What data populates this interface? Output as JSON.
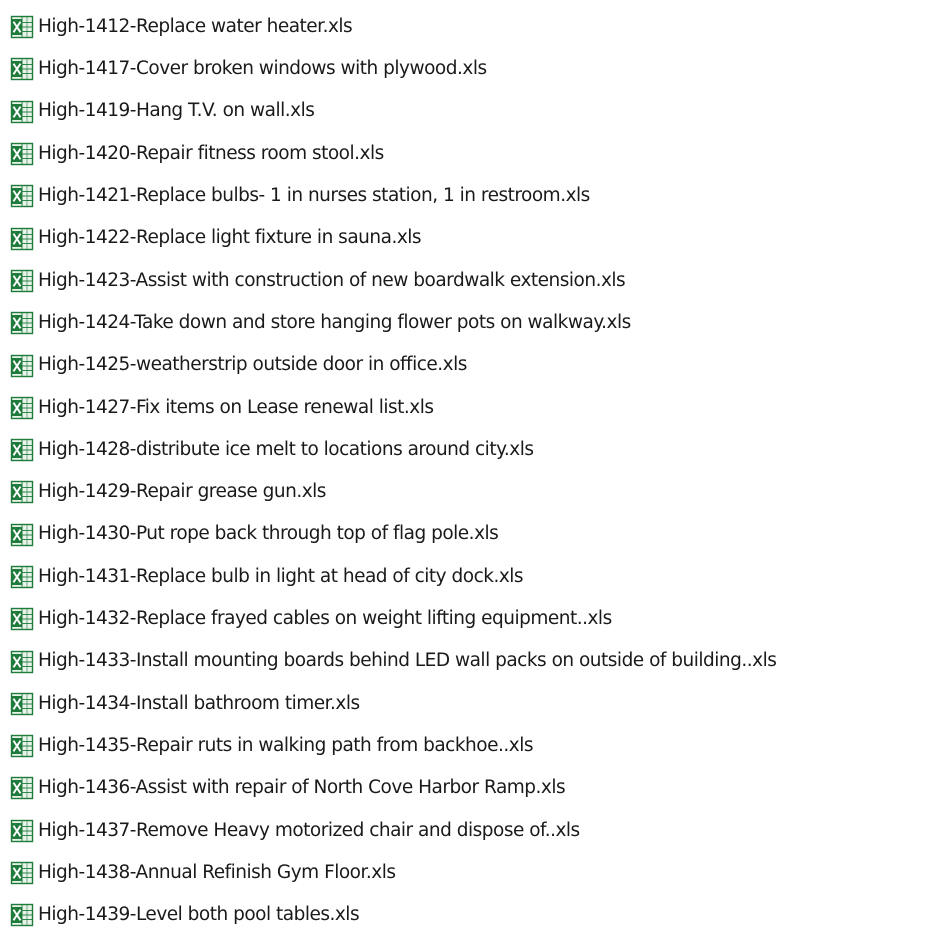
{
  "files": [
    {
      "name": "High-1412-Replace water heater.xls",
      "icon": "excel-file-icon"
    },
    {
      "name": "High-1417-Cover broken windows with plywood.xls",
      "icon": "excel-file-icon"
    },
    {
      "name": "High-1419-Hang T.V. on wall.xls",
      "icon": "excel-file-icon"
    },
    {
      "name": "High-1420-Repair fitness room stool.xls",
      "icon": "excel-file-icon"
    },
    {
      "name": "High-1421-Replace bulbs- 1 in nurses station, 1 in restroom.xls",
      "icon": "excel-file-icon"
    },
    {
      "name": "High-1422-Replace light fixture in sauna.xls",
      "icon": "excel-file-icon"
    },
    {
      "name": "High-1423-Assist with construction of new boardwalk extension.xls",
      "icon": "excel-file-icon"
    },
    {
      "name": "High-1424-Take down and store hanging flower pots on walkway.xls",
      "icon": "excel-file-icon"
    },
    {
      "name": "High-1425-weatherstrip outside door in office.xls",
      "icon": "excel-file-icon"
    },
    {
      "name": "High-1427-Fix items on Lease renewal list.xls",
      "icon": "excel-file-icon"
    },
    {
      "name": "High-1428-distribute ice melt to locations around city.xls",
      "icon": "excel-file-icon"
    },
    {
      "name": "High-1429-Repair grease gun.xls",
      "icon": "excel-file-icon"
    },
    {
      "name": "High-1430-Put rope back through top of flag pole.xls",
      "icon": "excel-file-icon"
    },
    {
      "name": "High-1431-Replace bulb in light at head of city dock.xls",
      "icon": "excel-file-icon"
    },
    {
      "name": "High-1432-Replace frayed cables on weight lifting equipment..xls",
      "icon": "excel-file-icon"
    },
    {
      "name": "High-1433-Install mounting boards behind LED wall packs on outside of building..xls",
      "icon": "excel-file-icon"
    },
    {
      "name": "High-1434-Install bathroom timer.xls",
      "icon": "excel-file-icon"
    },
    {
      "name": "High-1435-Repair ruts in walking path from backhoe..xls",
      "icon": "excel-file-icon"
    },
    {
      "name": "High-1436-Assist with repair of North Cove Harbor Ramp.xls",
      "icon": "excel-file-icon"
    },
    {
      "name": "High-1437-Remove Heavy motorized chair and dispose of..xls",
      "icon": "excel-file-icon"
    },
    {
      "name": "High-1438-Annual Refinish Gym Floor.xls",
      "icon": "excel-file-icon"
    },
    {
      "name": "High-1439-Level both pool tables.xls",
      "icon": "excel-file-icon"
    }
  ],
  "colors": {
    "icon_green": "#1e7b3c",
    "icon_light": "#e8f3e9",
    "text": "#1a1a1a"
  }
}
